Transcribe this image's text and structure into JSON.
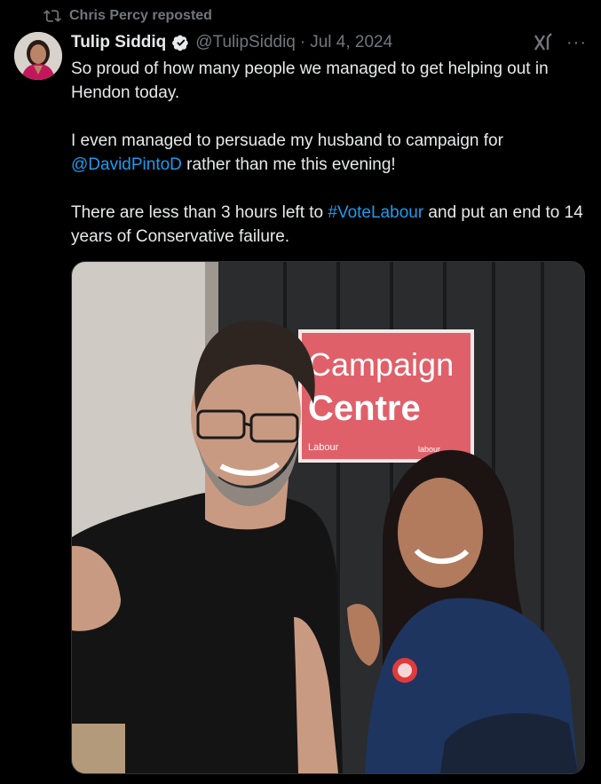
{
  "repost": {
    "text": "Chris Percy reposted",
    "icon": "repost-icon"
  },
  "author": {
    "name": "Tulip Siddiq",
    "verified": true,
    "handle": "@TulipSiddiq",
    "separator": "·",
    "date": "Jul 4, 2024",
    "avatar_icon": "avatar"
  },
  "actions": {
    "grok_icon": "grok-icon",
    "more_label": "···"
  },
  "tweet": {
    "line1": "So proud of how many people we managed to get helping out in Hendon today.",
    "line2_before": "I even managed to persuade my husband to campaign for ",
    "mention": "@DavidPintoD",
    "line2_after": " rather than me this evening!",
    "line3_before": "There are less than 3 hours left to ",
    "hashtag": "#VoteLabour",
    "line3_after": " and put an end to 14 years of Conservative failure."
  },
  "media": {
    "sign_line1": "Campaign",
    "sign_line2": "Centre",
    "sign_party": "Labour",
    "sign_url": "labour..."
  },
  "colors": {
    "background": "#000000",
    "text": "#e7e9ea",
    "muted": "#71767b",
    "link": "#1d9bf0",
    "sign": "#e0606a"
  }
}
